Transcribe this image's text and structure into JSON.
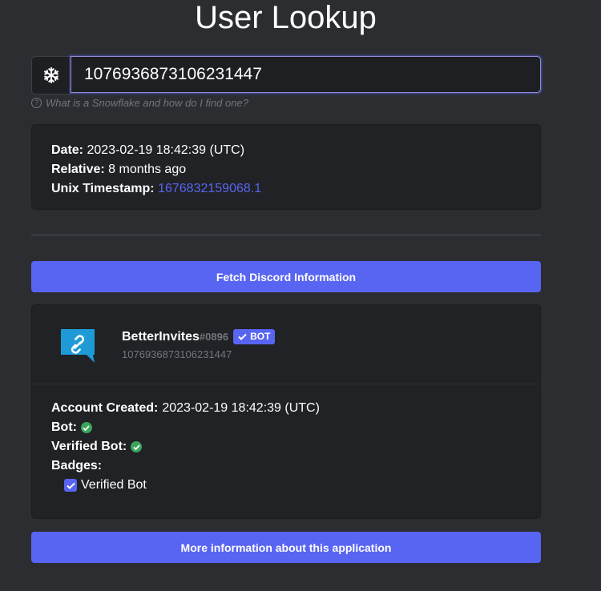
{
  "page": {
    "title": "User Lookup"
  },
  "search": {
    "icon": "snowflake-icon",
    "value": "1076936873106231447",
    "help_text": "What is a Snowflake and how do I find one?"
  },
  "snowflake_info": {
    "date_label": "Date:",
    "date_value": "2023-02-19 18:42:39 (UTC)",
    "relative_label": "Relative:",
    "relative_value": "8 months ago",
    "unix_label": "Unix Timestamp:",
    "unix_value": "1676832159068.1"
  },
  "fetch_button": {
    "label": "Fetch Discord Information"
  },
  "user": {
    "username": "BetterInvites",
    "discriminator": "#0896",
    "bot_badge": "BOT",
    "id": "1076936873106231447",
    "account_created_label": "Account Created:",
    "account_created_value": "2023-02-19 18:42:39 (UTC)",
    "bot_label": "Bot:",
    "verified_bot_label": "Verified Bot:",
    "badges_label": "Badges:",
    "badges": [
      "Verified Bot"
    ]
  },
  "more_button": {
    "label": "More information about this application"
  },
  "colors": {
    "background": "#2b2d31",
    "card": "#202225",
    "accent": "#5865f2",
    "success": "#3ba55c",
    "avatar": "#1e9bd7"
  }
}
